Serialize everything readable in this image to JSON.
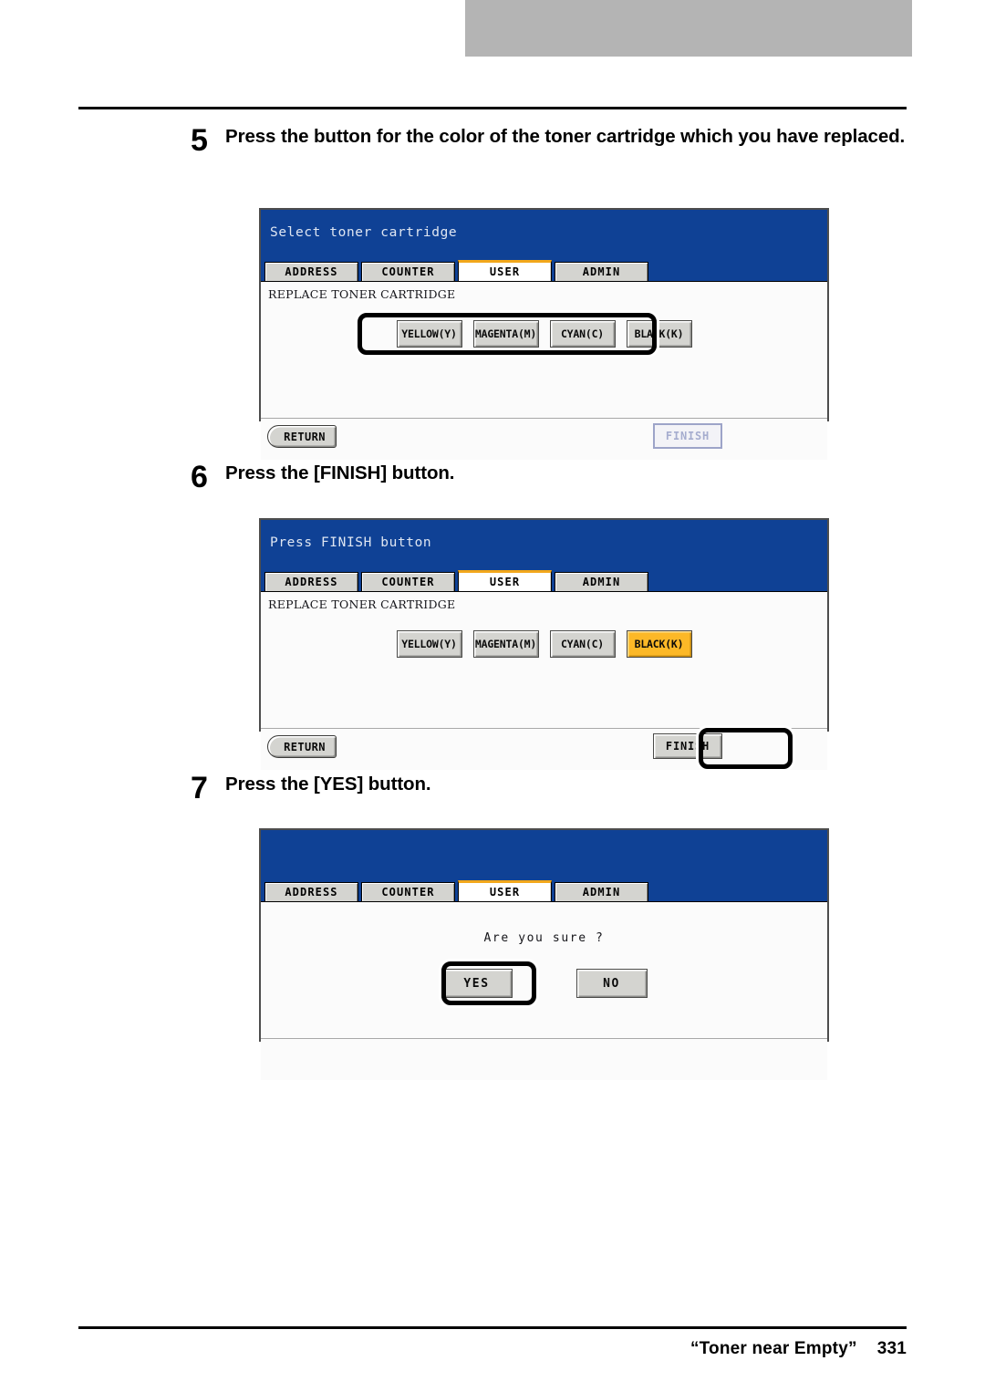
{
  "document": {
    "footer_title": "“Toner near Empty”",
    "page_number": "331"
  },
  "steps": [
    {
      "number": "5",
      "text": "Press the button for the color of the toner cartridge which you have replaced."
    },
    {
      "number": "6",
      "text": "Press the [FINISH] button."
    },
    {
      "number": "7",
      "text": "Press the [YES] button."
    }
  ],
  "tabs": [
    {
      "label": "ADDRESS",
      "active": false
    },
    {
      "label": "COUNTER",
      "active": false
    },
    {
      "label": "USER",
      "active": true
    },
    {
      "label": "ADMIN",
      "active": false
    }
  ],
  "panel1": {
    "header_title": "Select toner cartridge",
    "subtitle": "REPLACE TONER CARTRIDGE",
    "color_buttons": [
      {
        "label": "YELLOW(Y)",
        "selected": false
      },
      {
        "label": "MAGENTA(M)",
        "selected": false
      },
      {
        "label": "CYAN(C)",
        "selected": false
      },
      {
        "label": "BLACK(K)",
        "selected": false
      }
    ],
    "return_label": "RETURN",
    "finish_label": "FINISH",
    "finish_enabled": false
  },
  "panel2": {
    "header_title": "Press FINISH button",
    "subtitle": "REPLACE TONER CARTRIDGE",
    "color_buttons": [
      {
        "label": "YELLOW(Y)",
        "selected": false
      },
      {
        "label": "MAGENTA(M)",
        "selected": false
      },
      {
        "label": "CYAN(C)",
        "selected": false
      },
      {
        "label": "BLACK(K)",
        "selected": true
      }
    ],
    "return_label": "RETURN",
    "finish_label": "FINISH",
    "finish_enabled": true
  },
  "panel3": {
    "header_title": "",
    "confirm_message": "Are you sure ?",
    "yes_label": "YES",
    "no_label": "NO"
  },
  "colors": {
    "lcd_blue": "#0f4195",
    "tab_active_accent": "#f2a71b",
    "selected_button": "#fcb827",
    "button_face": "#d4d4d0",
    "disabled_text": "#a6adcf",
    "top_bar_gray": "#b4b4b4"
  }
}
